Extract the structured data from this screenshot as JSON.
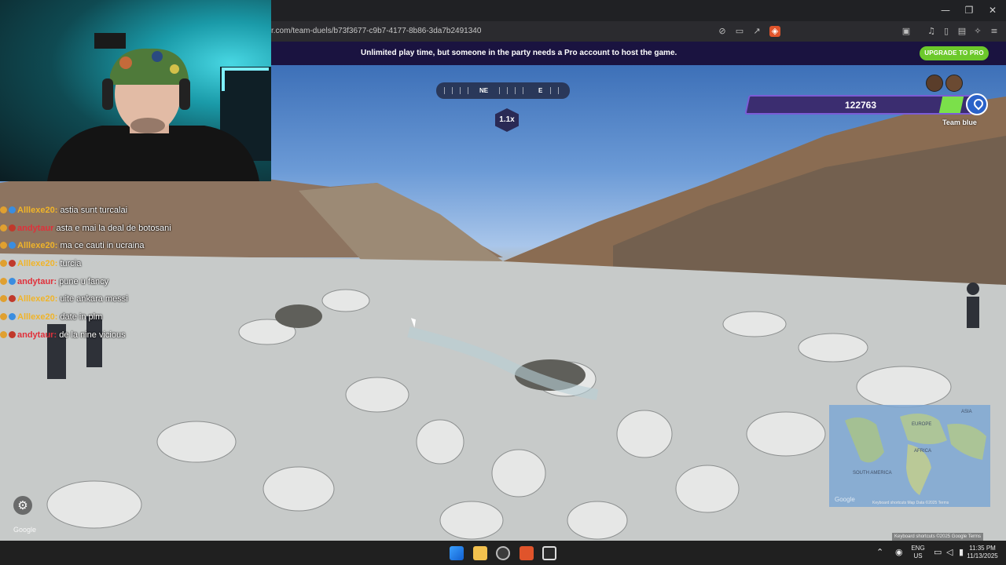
{
  "browser": {
    "url": "r.com/team-duels/b73f3677-c9b7-4177-8b86-3da7b2491340",
    "window_controls": [
      "—",
      "❐",
      "✕"
    ],
    "toolbar_icons": [
      "mute-icon",
      "cast-icon",
      "share-icon",
      "brave-shield-icon",
      "screenshot-icon",
      "music-icon",
      "sidebar-icon",
      "wallet-icon",
      "leo-ai-icon",
      "menu-icon"
    ]
  },
  "banner": {
    "text": "Unlimited play time, but someone in the party needs a Pro account to host the game.",
    "upgrade_label": "UPGRADE TO PRO"
  },
  "game": {
    "compass": {
      "ne": "NE",
      "e": "E"
    },
    "multiplier": "1.1x",
    "team_health": "122763",
    "team_name": "Team blue",
    "health_fraction": 0.1,
    "settings_icon": "⚙",
    "google_label": "Google"
  },
  "chat": [
    {
      "user": "Alllexe20:",
      "message": "astia sunt turcalai",
      "color": "#f0b429"
    },
    {
      "user": "andytaur",
      "message": "asta e mai la deal de botosani",
      "color": "#e0303a"
    },
    {
      "user": "Alllexe20:",
      "message": "ma ce cauti in ucraina",
      "color": "#f0b429"
    },
    {
      "user": "Alllexe20:",
      "message": "turcia",
      "color": "#f0b429"
    },
    {
      "user": "andytaur:",
      "message": "pune u fancy",
      "color": "#e0303a"
    },
    {
      "user": "Alllexe20:",
      "message": "uite ankara messi",
      "color": "#f0b429"
    },
    {
      "user": "Alllexe20:",
      "message": "date in plm",
      "color": "#f0b429"
    },
    {
      "user": "andytaur:",
      "message": "de la nine vicious",
      "color": "#e0303a"
    }
  ],
  "minimap": {
    "labels": [
      "EUROPE",
      "AFRICA",
      "ASIA",
      "SOUTH AMERICA"
    ],
    "google": "Google",
    "footer": "Keyboard shortcuts   Map Data ©2025   Terms"
  },
  "maps_footer": "Keyboard shortcuts  ©2025 Google  Terms",
  "taskbar": {
    "language": "ENG",
    "region": "US",
    "time": "11:35 PM",
    "date": "11/13/2025",
    "tray_icons": [
      "chevron-up-icon",
      "microphone-icon",
      "wifi-icon",
      "volume-icon",
      "battery-icon"
    ]
  }
}
